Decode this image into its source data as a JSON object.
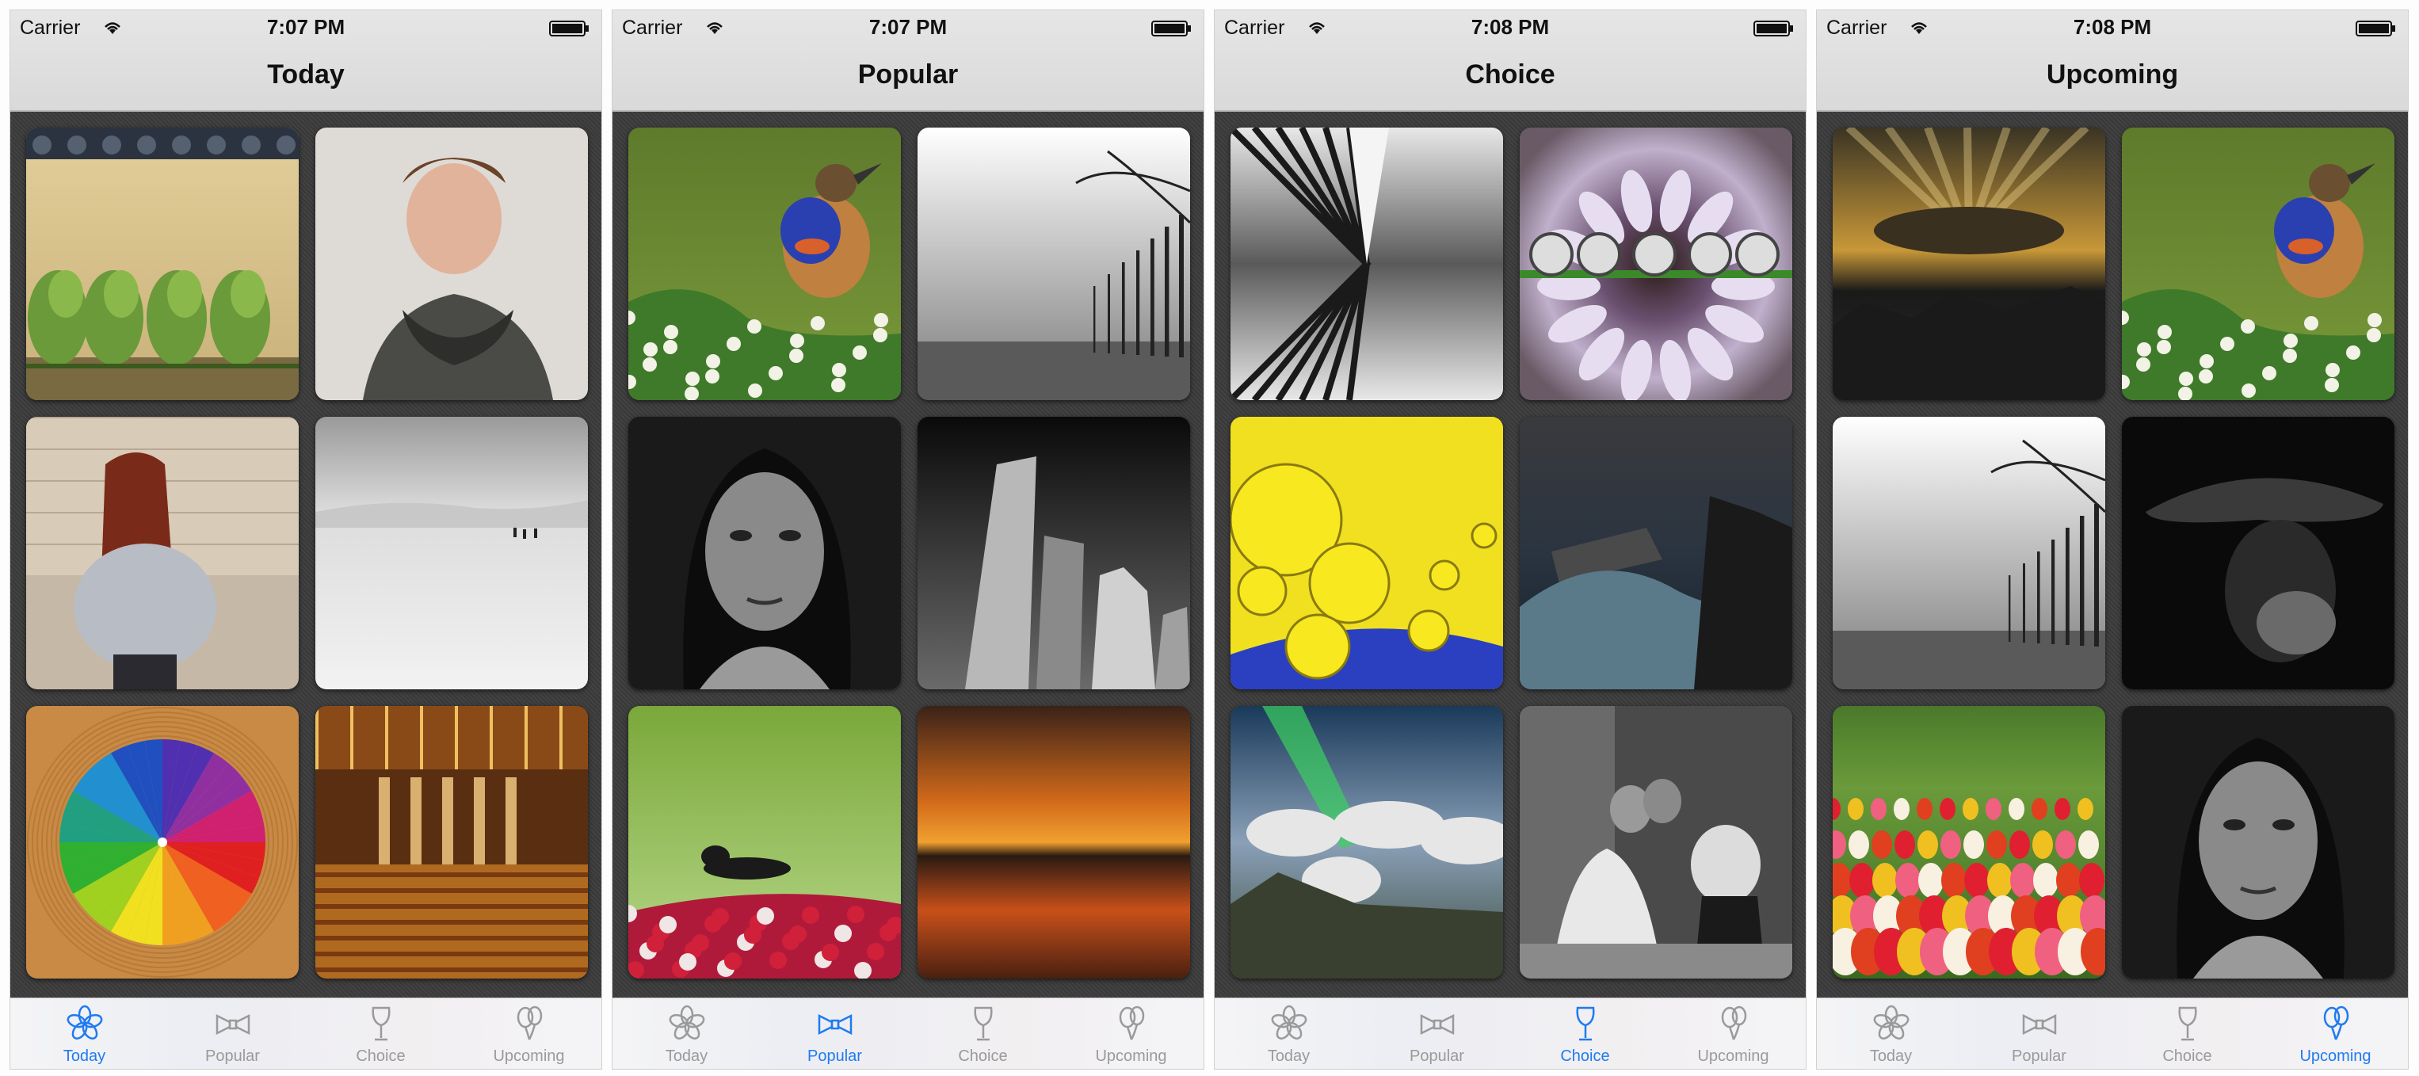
{
  "screens": [
    {
      "carrier": "Carrier",
      "time": "7:07 PM",
      "title": "Today",
      "active_tab": "Today",
      "photos": [
        "bamboo wall with green plants",
        "young man with dark scarf",
        "woman in fluffy sweater",
        "snowy landscape with walkers",
        "color pencil wheel",
        "concert hall interior"
      ]
    },
    {
      "carrier": "Carrier",
      "time": "7:07 PM",
      "title": "Popular",
      "active_tab": "Popular",
      "photos": [
        "bluethroat bird on blossoms",
        "foggy tree avenue",
        "black and white portrait of woman",
        "skyscrapers black and white",
        "wasp on red flowers",
        "sunset over water"
      ]
    },
    {
      "carrier": "Carrier",
      "time": "7:08 PM",
      "title": "Choice",
      "active_tab": "Choice",
      "photos": [
        "subway station reflection",
        "flower with water droplets",
        "yellow oil bubbles",
        "ship in stormy sea",
        "northern lights over coast",
        "couple with pug black and white"
      ]
    },
    {
      "carrier": "Carrier",
      "time": "7:08 PM",
      "title": "Upcoming",
      "active_tab": "Upcoming",
      "photos": [
        "sun rays over city",
        "bluethroat bird on blossoms",
        "foggy tree avenue",
        "man in cowboy hat",
        "tulip field",
        "black and white portrait of woman"
      ]
    }
  ],
  "tabs": [
    {
      "label": "Today",
      "icon": "flower-icon"
    },
    {
      "label": "Popular",
      "icon": "bowtie-icon"
    },
    {
      "label": "Choice",
      "icon": "wine-glass-icon"
    },
    {
      "label": "Upcoming",
      "icon": "balloons-icon"
    }
  ],
  "colors": {
    "active_tab": "#1f7bf0",
    "inactive_tab": "#9a9a9a",
    "navbar": "#dddddd",
    "background": "#3c3c3c"
  }
}
